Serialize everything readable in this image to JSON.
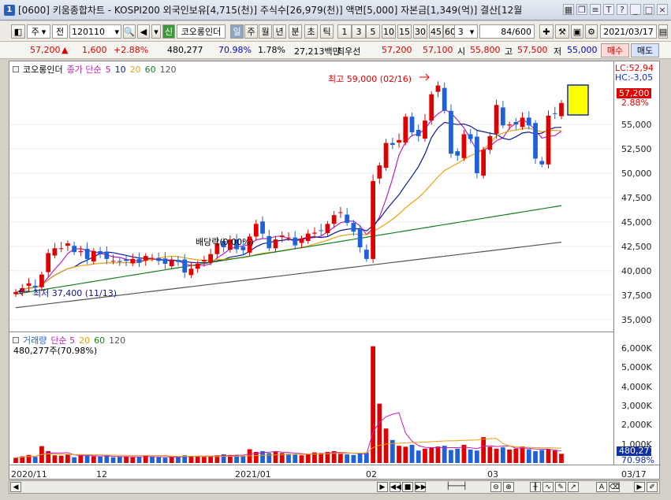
{
  "window": {
    "badge": "1",
    "title": "[0600] 키움종합차트 - KOSPI200 외국인보유[4,715(천)] 주식수[26,979(천)] 액면[5,000] 자본금[1,349(억)] 결산[12월"
  },
  "toolbar": {
    "period_label": "주",
    "prev_label": "전",
    "code_value": "120110",
    "sin_label": "신",
    "stock_name": "코오롱인더",
    "tabs": [
      "일",
      "주",
      "월",
      "년",
      "분",
      "초",
      "틱"
    ],
    "numbers": [
      "1",
      "3",
      "5",
      "10",
      "15",
      "30",
      "45",
      "60"
    ],
    "interval_value": "3",
    "count_value": "84/600",
    "date_value": "2021/03/17"
  },
  "quote": {
    "price": "57,200",
    "change": "1,600",
    "change_pct": "+2.88%",
    "volume": "480,277",
    "volume_ratio": "70.98%",
    "turnover": "1.78%",
    "amount": "27,213백만",
    "best_label": "최우선",
    "best_ask": "57,200",
    "best_bid": "57,100",
    "low_label": "시",
    "open": "55,800",
    "high_label": "고",
    "high": "57,500",
    "low2_label": "저",
    "low": "55,000",
    "buy_label": "매수",
    "sell_label": "매도"
  },
  "chart": {
    "legend_name": "코오롱인더",
    "legend_price": "종가 단순",
    "ma_labels": [
      "5",
      "10",
      "20",
      "60",
      "120"
    ],
    "volume_title": "거래량",
    "volume_simple": "단순 5",
    "volume_ma": [
      "20",
      "60",
      "120"
    ],
    "volume_sub": "480,277주(70.98%)",
    "lc": "LC:52,94",
    "hc": "HC:-3,05",
    "last_price_tag": "57,200",
    "last_pct": "2.88%",
    "vol_tag": "480,277",
    "vol_pct": "70.98%",
    "annotation_high": "최고 59,000 (02/16)",
    "annotation_low": "최저 37,400 (11/13)",
    "annotation_div": "배당락(0.00%)",
    "y_ticks": [
      "55,000",
      "52,500",
      "50,000",
      "47,500",
      "45,000",
      "42,500",
      "40,000",
      "37,500",
      "35,000"
    ],
    "vol_ticks": [
      "6,000K",
      "5,000K",
      "4,000K",
      "3,000K",
      "2,000K",
      "1,000K"
    ],
    "x_ticks": [
      "2020/11",
      "12",
      "2021/01",
      "02",
      "03",
      "03/17"
    ]
  },
  "colors": {
    "up": "#e00000",
    "down": "#1f62d8",
    "ma5": "#c020c0",
    "ma10": "#101890",
    "ma20": "#e8a010",
    "ma60": "#108020",
    "ma120": "#555555"
  },
  "chart_data": {
    "type": "bar",
    "title": "",
    "xlabel": "",
    "ylabel": "",
    "ylim": [
      34000,
      60500
    ],
    "series": [
      {
        "name": "종가",
        "values": [
          37800,
          38200,
          38700,
          38300,
          39600,
          41800,
          42300,
          42300,
          42800,
          41900,
          42000,
          41200,
          42000,
          41700,
          41200,
          41000,
          40900,
          41000,
          41200,
          40800,
          41500,
          41300,
          41000,
          40700,
          41100,
          40900,
          39800,
          40200,
          40700,
          41100,
          41700,
          42800,
          42400,
          43200,
          42200,
          42100,
          43500,
          44800,
          43800,
          42300,
          43200,
          43600,
          43400,
          42600,
          43300,
          43800,
          43900,
          44100,
          44800,
          45700,
          46000,
          44900,
          44000,
          42400,
          41200,
          49200,
          50800,
          53100,
          52900,
          53400,
          55800,
          54200,
          53800,
          55400,
          58100,
          59000,
          56400,
          52000,
          51800,
          54000,
          53500,
          50000,
          52400,
          53800,
          57000,
          54900,
          55000,
          55000,
          55700,
          54900,
          51500,
          50900,
          55900,
          56100,
          57200
        ]
      }
    ],
    "volume": [
      0.27,
      0.35,
      0.42,
      0.32,
      0.88,
      0.62,
      0.4,
      0.38,
      0.43,
      0.3,
      0.42,
      0.4,
      0.35,
      0.33,
      0.38,
      0.3,
      0.32,
      0.35,
      0.3,
      0.33,
      0.38,
      0.32,
      0.3,
      0.28,
      0.32,
      0.35,
      0.4,
      0.37,
      0.36,
      0.32,
      0.35,
      0.4,
      0.45,
      0.42,
      0.4,
      0.38,
      0.72,
      0.58,
      0.62,
      0.52,
      0.6,
      0.52,
      0.48,
      0.45,
      0.4,
      0.47,
      0.55,
      0.52,
      0.58,
      0.62,
      0.48,
      0.45,
      0.42,
      0.5,
      0.55,
      6.1,
      3.1,
      1.8,
      1.2,
      0.9,
      0.85,
      0.95,
      0.65,
      0.75,
      0.82,
      0.86,
      0.9,
      0.68,
      0.75,
      0.95,
      0.7,
      0.65,
      1.35,
      0.85,
      0.75,
      0.82,
      0.7,
      0.75,
      0.86,
      0.72,
      0.62,
      0.68,
      0.72,
      0.65,
      0.48
    ]
  }
}
